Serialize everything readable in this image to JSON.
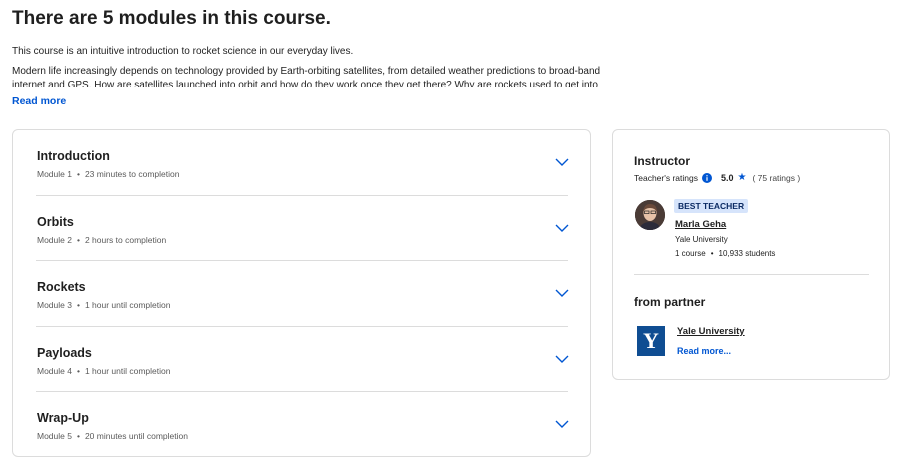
{
  "heading": "There are 5 modules in this course.",
  "description": {
    "p1": "This course is an intuitive introduction to rocket science in our everyday lives.",
    "p2": "Modern life increasingly depends on technology provided by Earth-orbiting satellites, from detailed weather predictions to broad-band internet and GPS. How are satellites launched into orbit and how do they work once they get there? Why are rockets used to get into",
    "read_more": "Read more"
  },
  "modules": [
    {
      "title": "Introduction",
      "module": "Module 1",
      "duration": "23 minutes to completion"
    },
    {
      "title": "Orbits",
      "module": "Module 2",
      "duration": "2 hours to completion"
    },
    {
      "title": "Rockets",
      "module": "Module 3",
      "duration": "1 hour until completion"
    },
    {
      "title": "Payloads",
      "module": "Module 4",
      "duration": "1 hour until completion"
    },
    {
      "title": "Wrap-Up",
      "module": "Module 5",
      "duration": "20 minutes until completion"
    }
  ],
  "meta_separator": "•",
  "instructor": {
    "section_title": "Instructor",
    "ratings_label": "Teacher's ratings",
    "score": "5.0",
    "star": "★",
    "ratings_count": "( 75 ratings )",
    "badge": "BEST TEACHER",
    "name": "Marla Geha",
    "university": "Yale University",
    "courses": "1 course",
    "students": "10,933 students"
  },
  "partner": {
    "section_title": "from partner",
    "logo_letter": "Y",
    "name": "Yale University",
    "read_more": "Read more..."
  },
  "colors": {
    "accent": "#0056d2",
    "badge_bg": "#d6e4fb",
    "yale_blue": "#0f4d92",
    "border": "#dcdcdc"
  }
}
